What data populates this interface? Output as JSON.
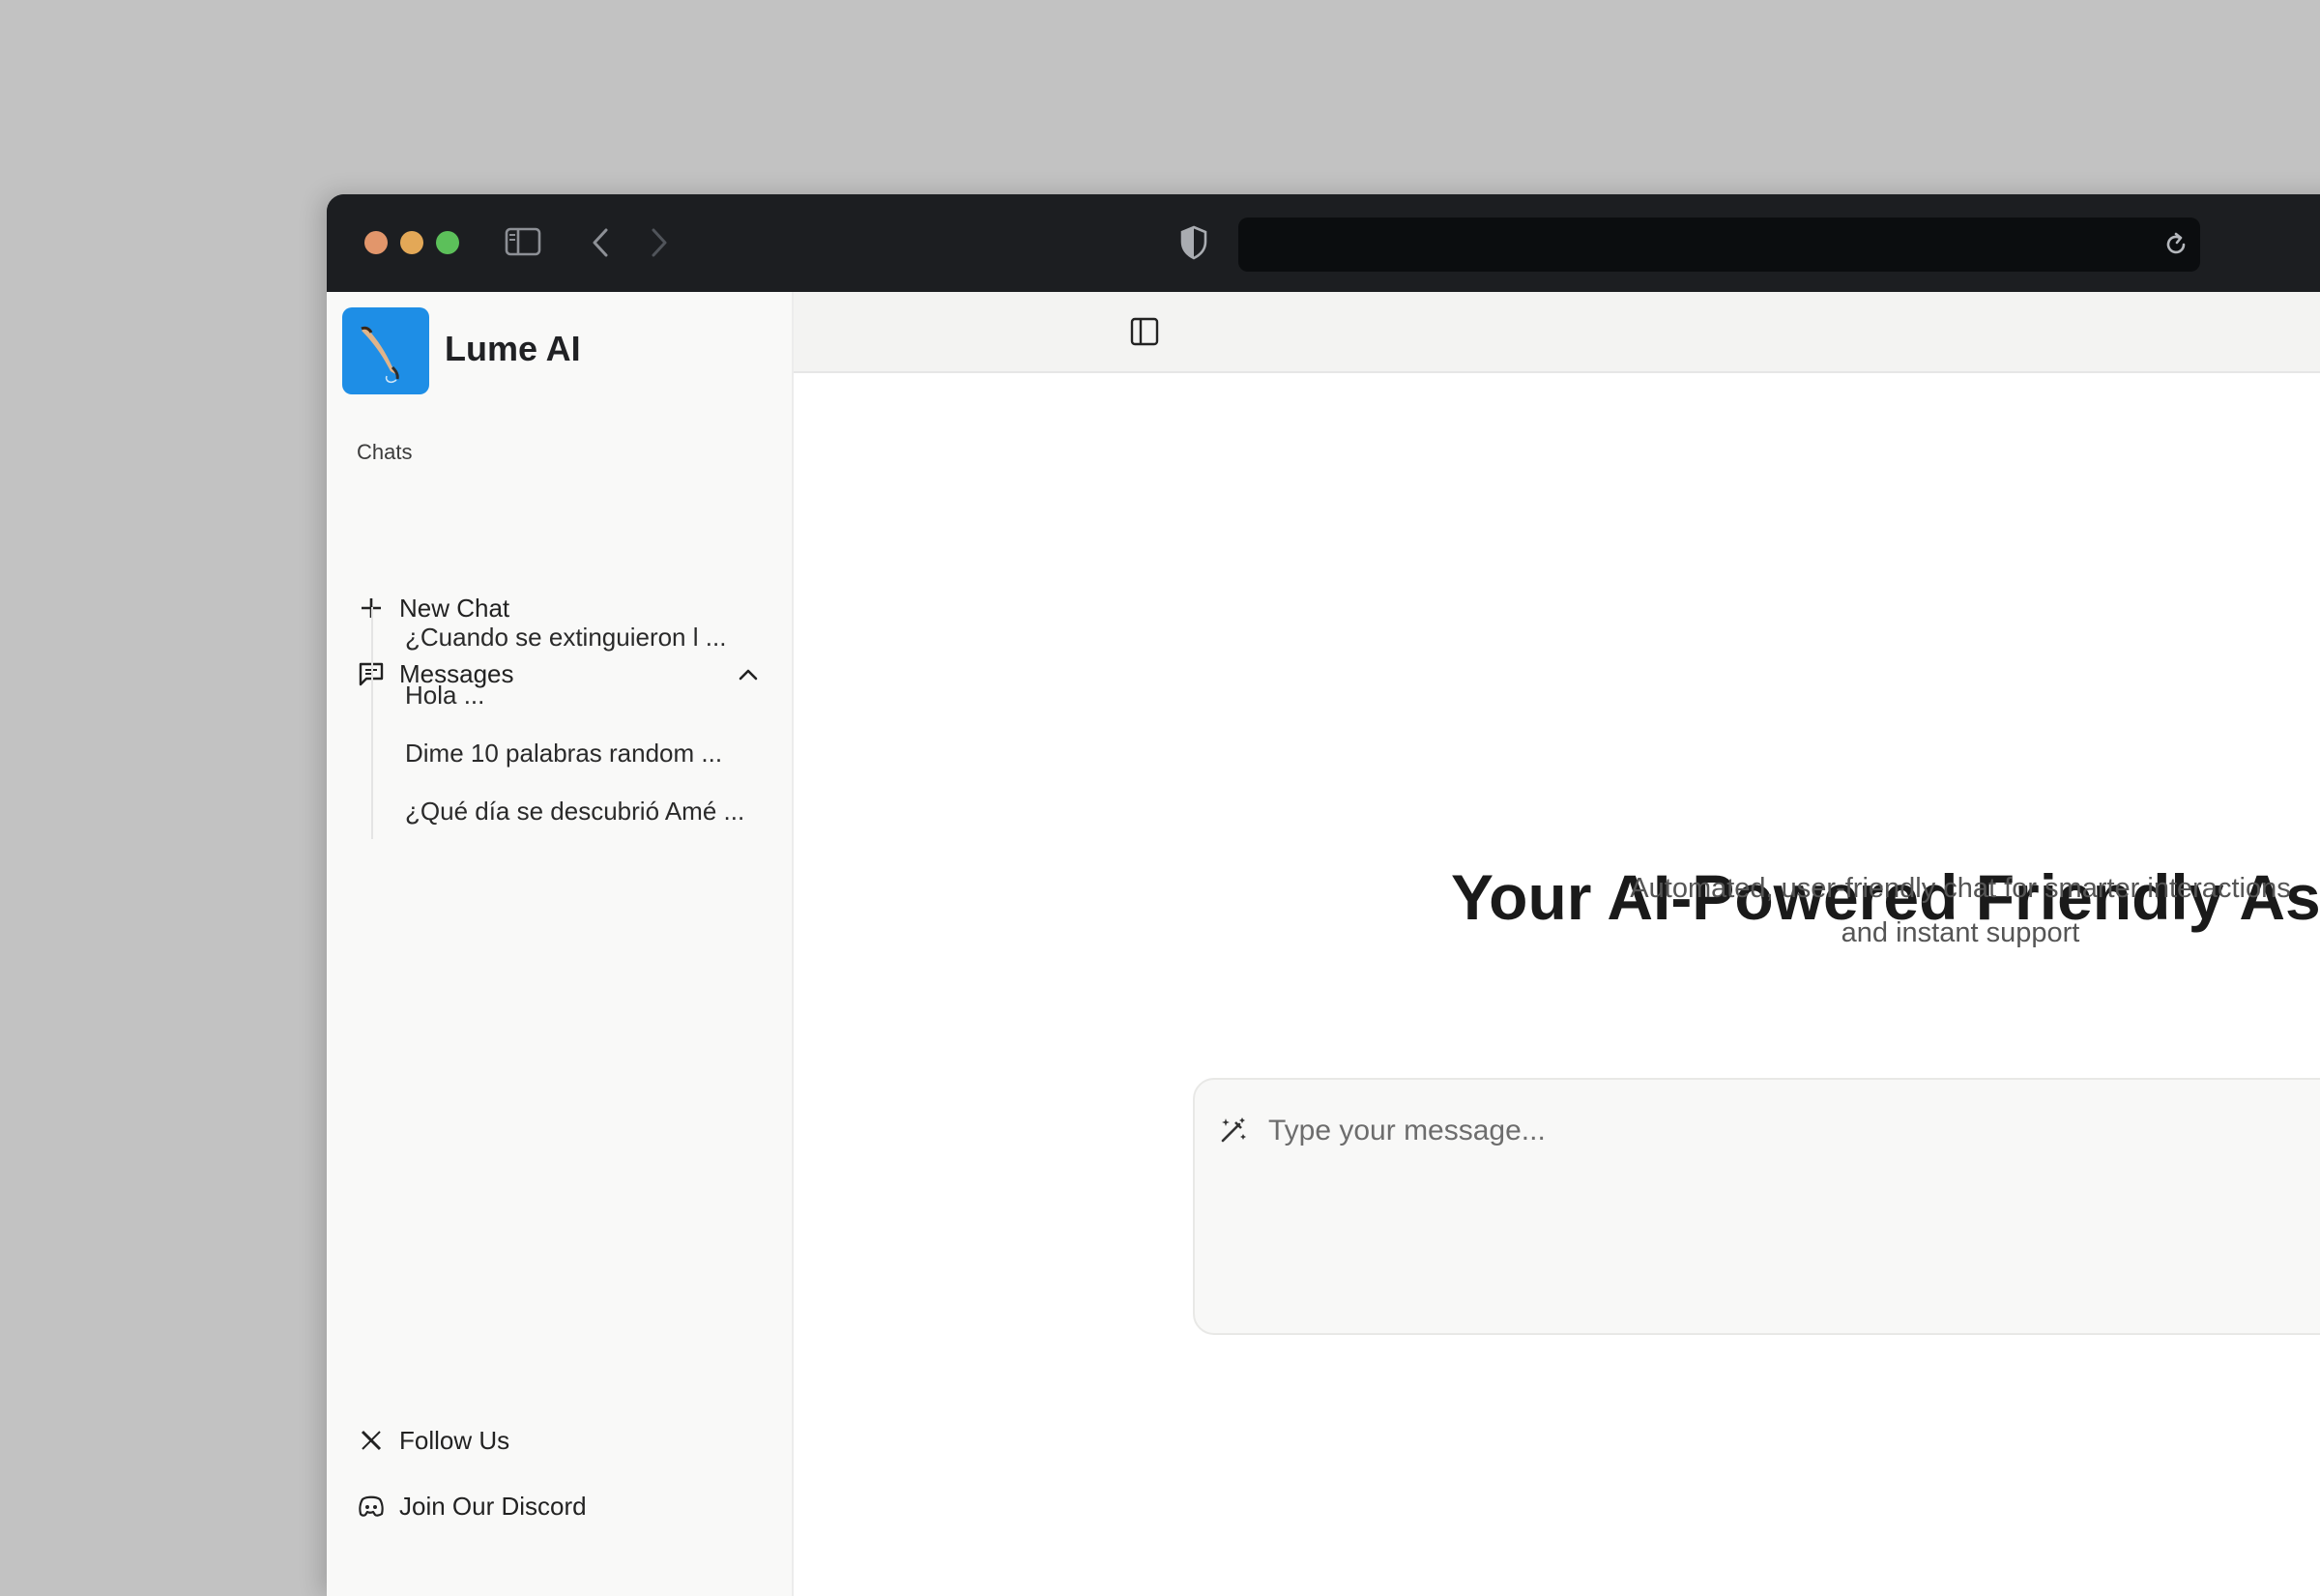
{
  "browser": {
    "address_value": ""
  },
  "sidebar": {
    "app_name": "Lume AI",
    "section_label": "Chats",
    "new_chat_label": "New Chat",
    "messages_label": "Messages",
    "messages": [
      "¿Cuando se extinguieron l ...",
      "Hola ...",
      "Dime 10 palabras random ...",
      "¿Qué día se descubrió Amé ..."
    ],
    "follow_label": "Follow Us",
    "discord_label": "Join Our Discord"
  },
  "main": {
    "title": "Your AI-Powered Friendly Asis",
    "subtitle_line1": "Automated, user-friendly chat for smarter interactions",
    "subtitle_line2": "and instant support",
    "input_placeholder": "Type your message..."
  },
  "colors": {
    "logo_bg": "#1e8ee6",
    "titlebar": "#1c1e21",
    "sidebar_bg": "#f9f9f8"
  }
}
